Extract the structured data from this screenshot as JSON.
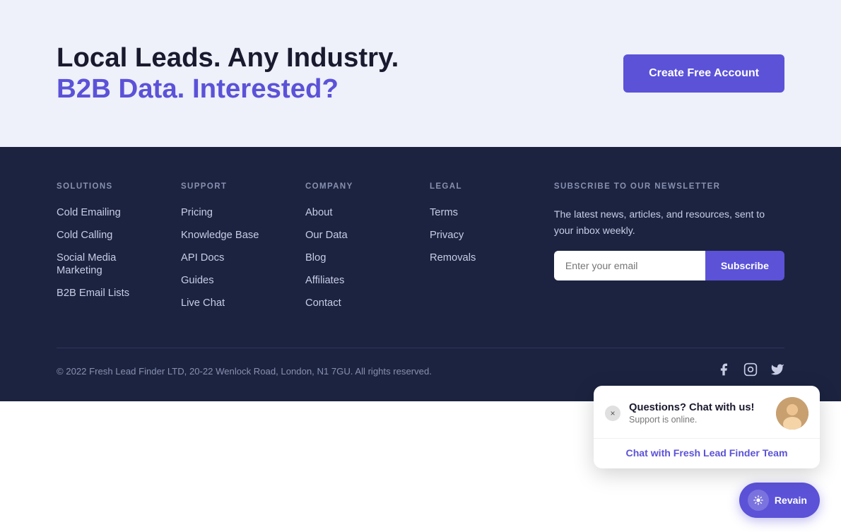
{
  "cta": {
    "headline_line1": "Local Leads. Any Industry.",
    "headline_line2": "B2B Data. Interested?",
    "button_label": "Create Free Account"
  },
  "footer": {
    "solutions": {
      "heading": "Solutions",
      "items": [
        {
          "label": "Cold Emailing",
          "href": "#"
        },
        {
          "label": "Cold Calling",
          "href": "#"
        },
        {
          "label": "Social Media Marketing",
          "href": "#"
        },
        {
          "label": "B2B Email Lists",
          "href": "#"
        }
      ]
    },
    "support": {
      "heading": "Support",
      "items": [
        {
          "label": "Pricing",
          "href": "#"
        },
        {
          "label": "Knowledge Base",
          "href": "#"
        },
        {
          "label": "API Docs",
          "href": "#"
        },
        {
          "label": "Guides",
          "href": "#"
        },
        {
          "label": "Live Chat",
          "href": "#"
        }
      ]
    },
    "company": {
      "heading": "Company",
      "items": [
        {
          "label": "About",
          "href": "#"
        },
        {
          "label": "Our Data",
          "href": "#"
        },
        {
          "label": "Blog",
          "href": "#"
        },
        {
          "label": "Affiliates",
          "href": "#"
        },
        {
          "label": "Contact",
          "href": "#"
        }
      ]
    },
    "legal": {
      "heading": "Legal",
      "items": [
        {
          "label": "Terms",
          "href": "#"
        },
        {
          "label": "Privacy",
          "href": "#"
        },
        {
          "label": "Removals",
          "href": "#"
        }
      ]
    },
    "newsletter": {
      "heading": "Subscribe To Our Newsletter",
      "description": "The latest news, articles, and resources, sent to your inbox weekly.",
      "input_placeholder": "Enter your email",
      "button_label": "Subscribe"
    },
    "copyright": "© 2022 Fresh Lead Finder LTD, 20-22 Wenlock Road, London, N1 7GU. All rights reserved."
  },
  "chat_popup": {
    "title": "Questions? Chat with us!",
    "status": "Support is online.",
    "link_label": "Chat with Fresh Lead Finder Team",
    "close_label": "×"
  },
  "revain": {
    "label": "Revain"
  }
}
